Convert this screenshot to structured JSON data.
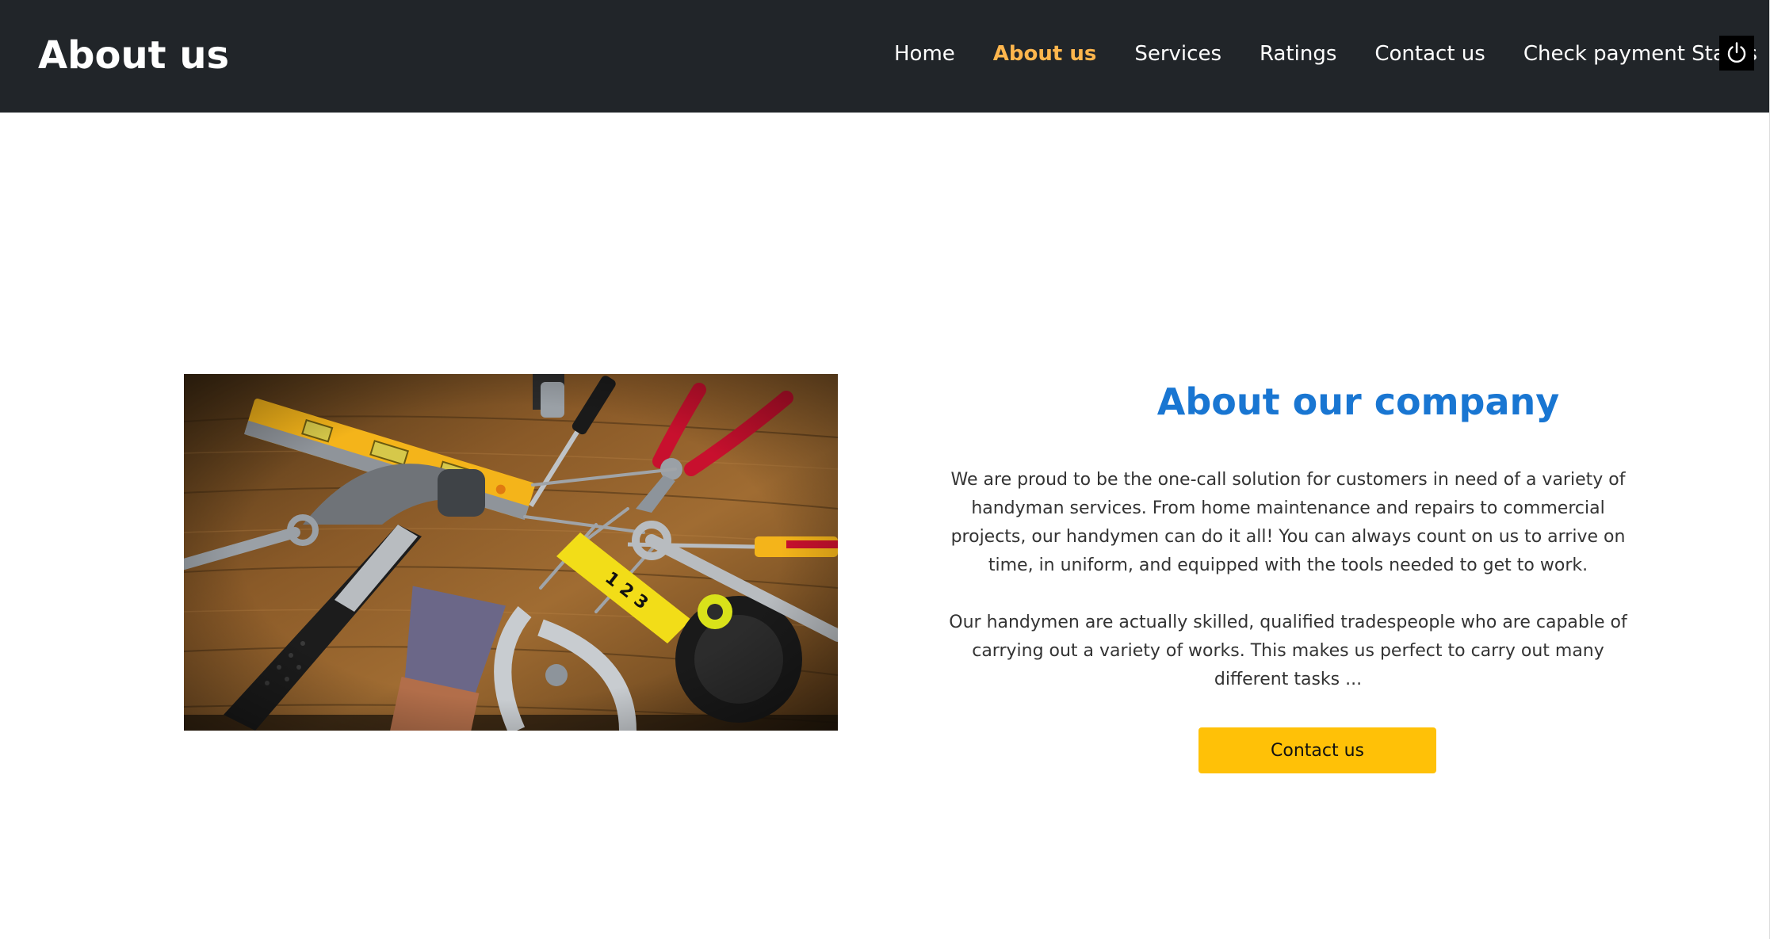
{
  "header": {
    "brand": "About us",
    "nav": [
      {
        "label": "Home",
        "active": false
      },
      {
        "label": "About us",
        "active": true
      },
      {
        "label": "Services",
        "active": false
      },
      {
        "label": "Ratings",
        "active": false
      },
      {
        "label": "Contact us",
        "active": false
      },
      {
        "label": "Check payment Status",
        "active": false
      }
    ],
    "power_icon": "power-icon"
  },
  "about": {
    "image_icon": "tools-photo",
    "title": "About our company",
    "paragraph1": "We are proud to be the one-call solution for customers in need of a variety of handyman services. From home maintenance and repairs to commercial projects, our handymen can do it all! You can always count on us to arrive on time, in uniform, and equipped with the tools needed to get to work.",
    "paragraph2": "Our handymen are actually skilled, qualified tradespeople who are capable of carrying out a variety of works. This makes us perfect to carry out many different tasks ...",
    "cta_label": "Contact us"
  },
  "colors": {
    "header_bg": "#212529",
    "nav_active": "#ffb64d",
    "title_blue": "#1976d2",
    "cta_yellow": "#ffc107"
  }
}
